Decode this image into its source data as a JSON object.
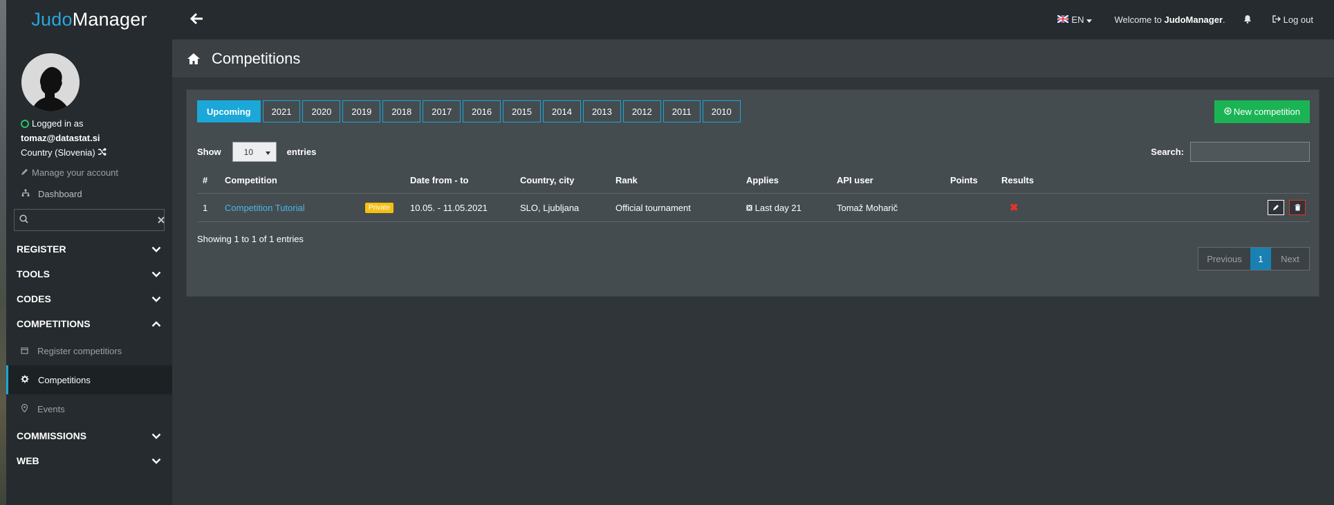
{
  "brand": {
    "part1": "Judo",
    "part2": "Manager"
  },
  "user": {
    "logged_in_label": "Logged in as",
    "email": "tomaz@datastat.si",
    "country": "Country (Slovenia)",
    "manage_account": "Manage your account"
  },
  "sidebar": {
    "dashboard": "Dashboard",
    "search_placeholder": "",
    "sections": {
      "register": "REGISTER",
      "tools": "TOOLS",
      "codes": "CODES",
      "competitions": "COMPETITIONS",
      "commissions": "COMMISSIONS",
      "web": "WEB"
    },
    "competition_items": [
      "Register competitiors",
      "Competitions",
      "Events"
    ]
  },
  "topbar": {
    "lang": "EN",
    "welcome_prefix": "Welcome to ",
    "welcome_brand": "JudoManager",
    "welcome_suffix": ".",
    "logout": "Log out"
  },
  "page": {
    "title": "Competitions"
  },
  "year_tabs": [
    "Upcoming",
    "2021",
    "2020",
    "2019",
    "2018",
    "2017",
    "2016",
    "2015",
    "2014",
    "2013",
    "2012",
    "2011",
    "2010"
  ],
  "new_competition": "New competition",
  "table_controls": {
    "show": "Show",
    "entries_value": "10",
    "entries": "entries",
    "search": "Search:"
  },
  "table": {
    "headers": [
      "#",
      "Competition",
      "Date from - to",
      "Country, city",
      "Rank",
      "Applies",
      "API user",
      "Points",
      "Results",
      ""
    ],
    "rows": [
      {
        "num": "1",
        "competition": "Competition Tutorial",
        "badge": "Private",
        "dates": "10.05. - 11.05.2021",
        "location": "SLO, Ljubljana",
        "rank": "Official tournament",
        "applies": "Last day 21",
        "api_user": "Tomaž Moharič",
        "points": "",
        "results": "✖"
      }
    ]
  },
  "info": "Showing 1 to 1 of 1 entries",
  "pagination": {
    "previous": "Previous",
    "current": "1",
    "next": "Next"
  },
  "colors": {
    "accent": "#1ba7d8",
    "success": "#1bb455",
    "danger": "#e8322a",
    "badge": "#f6c012"
  }
}
